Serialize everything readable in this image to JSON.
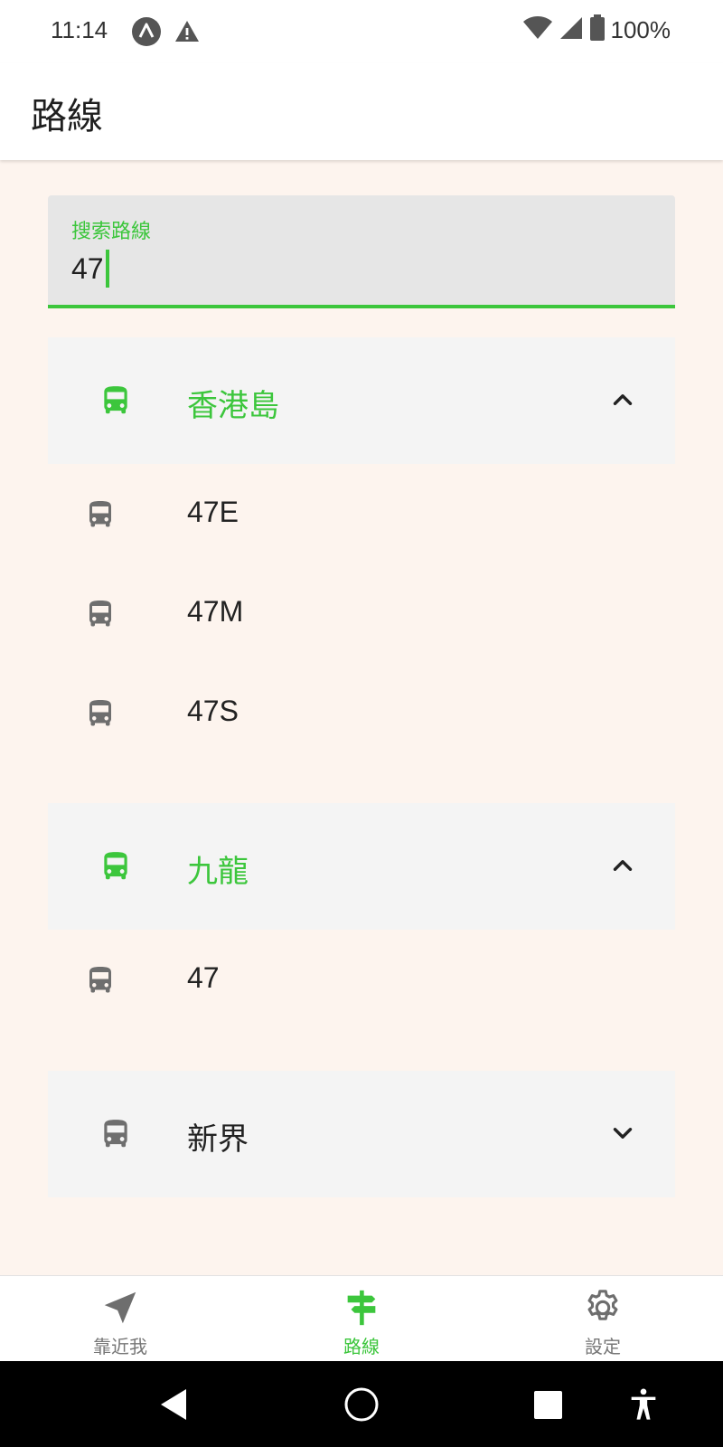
{
  "status": {
    "time": "11:14",
    "battery_text": "100%",
    "icons": [
      "app-notification-icon",
      "warning-icon",
      "wifi-icon",
      "signal-icon",
      "battery-icon"
    ]
  },
  "appbar": {
    "title": "路線"
  },
  "search": {
    "label": "搜索路線",
    "value": "47"
  },
  "groups": [
    {
      "label": "香港島",
      "expanded": true,
      "icon": "bus-icon"
    },
    {
      "label": "九龍",
      "expanded": true,
      "icon": "bus-icon"
    },
    {
      "label": "新界",
      "expanded": false,
      "icon": "bus-icon"
    }
  ],
  "routes": [
    {
      "label": "47E",
      "group": "香港島"
    },
    {
      "label": "47M",
      "group": "香港島"
    },
    {
      "label": "47S",
      "group": "香港島"
    },
    {
      "label": "47",
      "group": "九龍"
    }
  ],
  "bottom_nav": [
    {
      "label": "靠近我",
      "icon": "near-me-icon",
      "active": false
    },
    {
      "label": "路線",
      "icon": "signpost-icon",
      "active": true
    },
    {
      "label": "設定",
      "icon": "gear-icon",
      "active": false
    }
  ],
  "colors": {
    "accent": "#3cc63c",
    "background": "#fdf4ee",
    "header_bg": "#f4f4f4",
    "icon_inactive": "#6e6e6e"
  }
}
